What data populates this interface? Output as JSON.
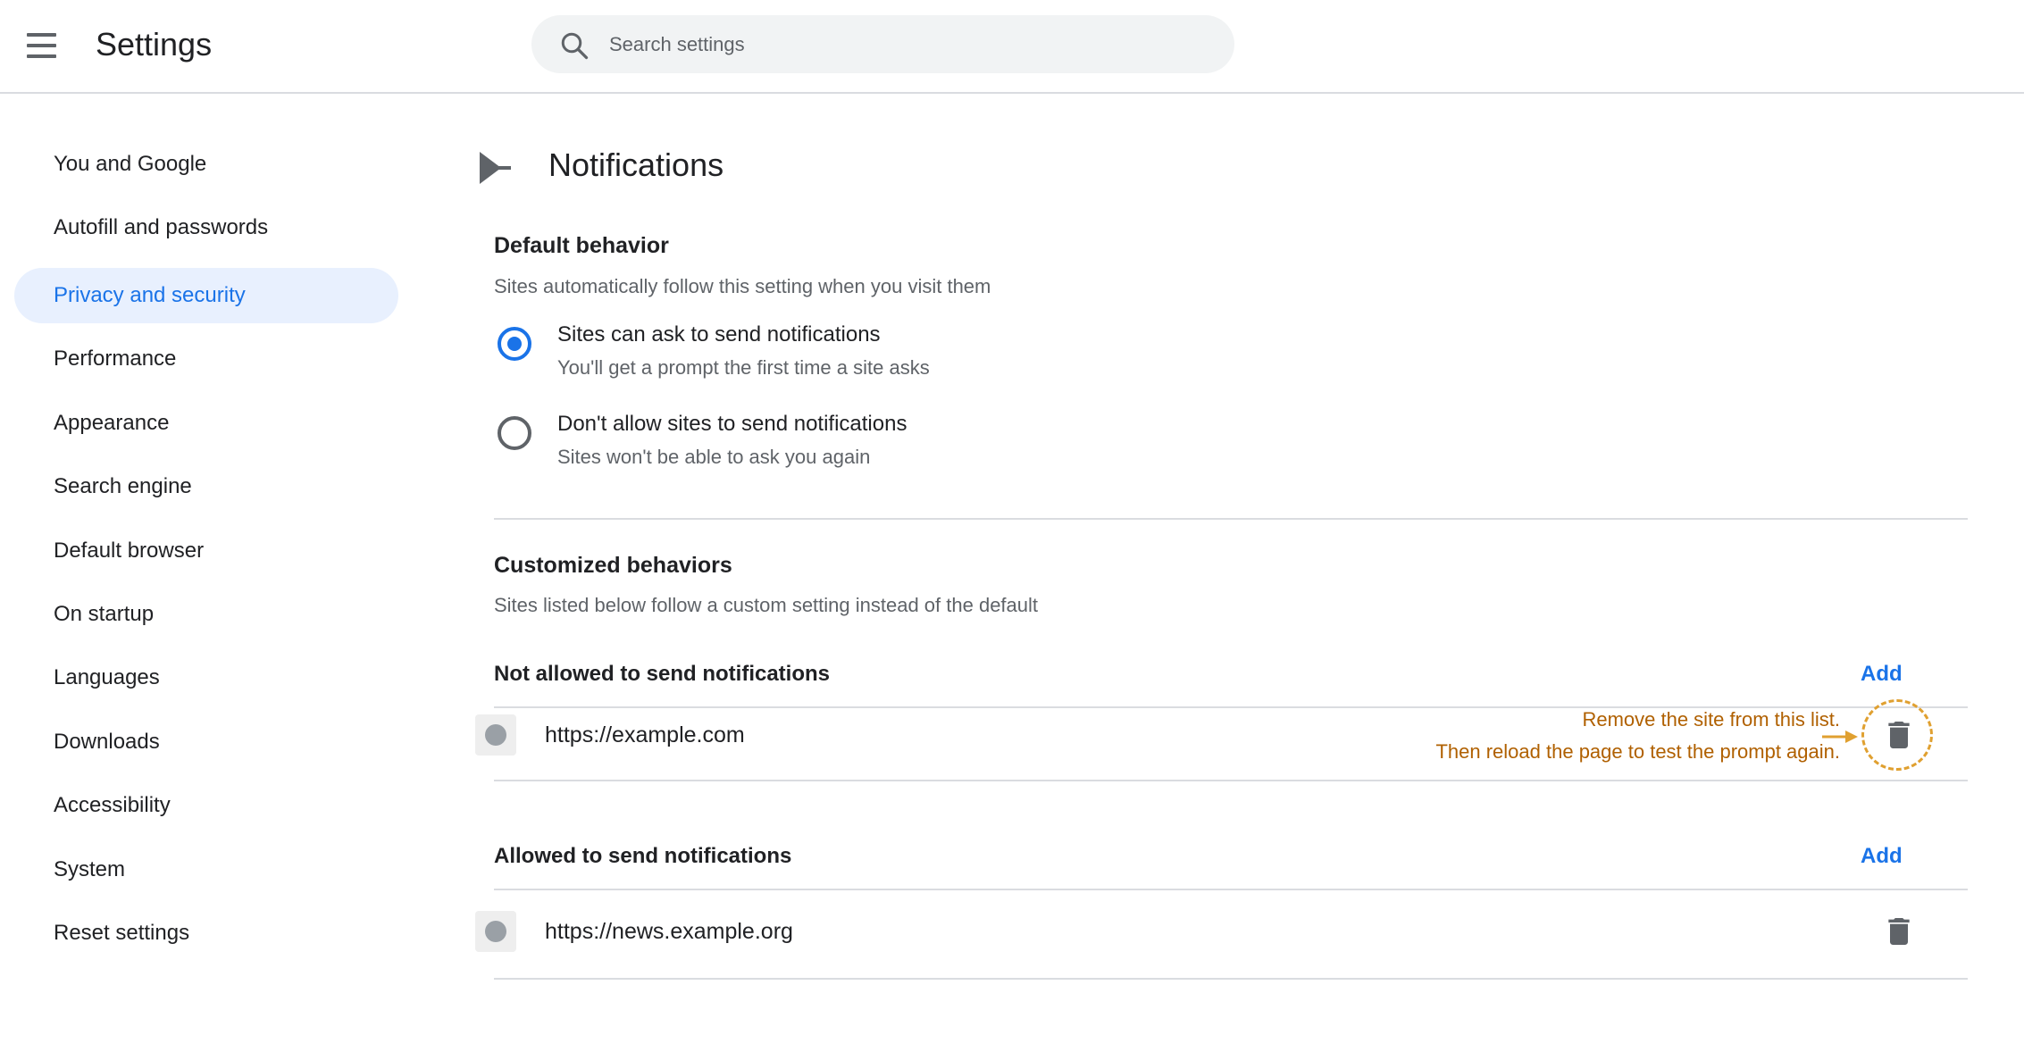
{
  "header": {
    "title": "Settings",
    "search": {
      "placeholder": "Search settings",
      "value": ""
    }
  },
  "sidebar": {
    "items": [
      {
        "label": "You and Google",
        "active": false
      },
      {
        "label": "Autofill and passwords",
        "active": false
      },
      {
        "label": "Privacy and security",
        "active": true
      },
      {
        "label": "Performance",
        "active": false
      },
      {
        "label": "Appearance",
        "active": false
      },
      {
        "label": "Search engine",
        "active": false
      },
      {
        "label": "Default browser",
        "active": false
      },
      {
        "label": "On startup",
        "active": false
      },
      {
        "label": "Languages",
        "active": false
      },
      {
        "label": "Downloads",
        "active": false
      },
      {
        "label": "Accessibility",
        "active": false
      },
      {
        "label": "System",
        "active": false
      },
      {
        "label": "Reset settings",
        "active": false
      }
    ]
  },
  "main": {
    "title": "Notifications",
    "default_behavior": {
      "heading": "Default behavior",
      "description": "Sites automatically follow this setting when you visit them",
      "options": [
        {
          "label": "Sites can ask to send notifications",
          "sublabel": "You'll get a prompt the first time a site asks",
          "selected": true
        },
        {
          "label": "Don't allow sites to send notifications",
          "sublabel": "Sites won't be able to ask you again",
          "selected": false
        }
      ]
    },
    "customized": {
      "heading": "Customized behaviors",
      "description": "Sites listed below follow a custom setting instead of the default",
      "not_allowed": {
        "heading": "Not allowed to send notifications",
        "add_label": "Add",
        "sites": [
          {
            "url": "https://example.com"
          }
        ]
      },
      "allowed": {
        "heading": "Allowed to send notifications",
        "add_label": "Add",
        "sites": [
          {
            "url": "https://news.example.org"
          }
        ]
      }
    },
    "annotation": {
      "line1": "Remove the site from this list.",
      "line2": "Then reload the page to test the prompt again."
    }
  },
  "colors": {
    "accent": "#1a73e8",
    "active_nav_bg": "#e8f0fe",
    "annotation_text": "#b06000",
    "annotation_circle": "#e0a030",
    "icon_gray": "#5f6368"
  },
  "icons": {
    "menu": "hamburger-menu-icon",
    "search": "magnifier-icon",
    "back": "back-arrow-icon",
    "delete": "trash-icon"
  }
}
